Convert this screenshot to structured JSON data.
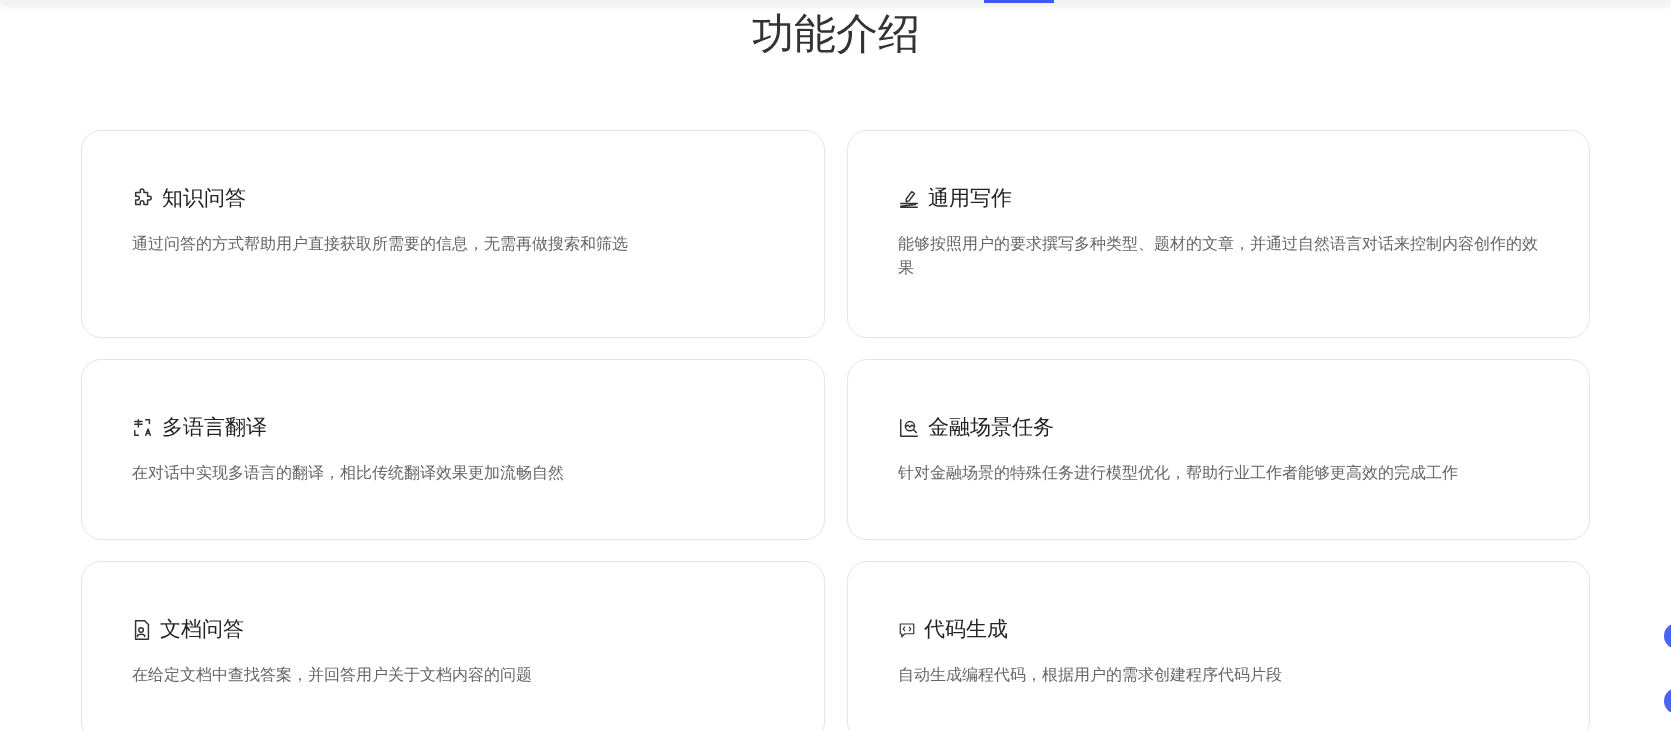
{
  "section_title": "功能介绍",
  "features": [
    {
      "title": "知识问答",
      "description": "通过问答的方式帮助用户直接获取所需要的信息，无需再做搜索和筛选"
    },
    {
      "title": "通用写作",
      "description": "能够按照用户的要求撰写多种类型、题材的文章，并通过自然语言对话来控制内容创作的效果"
    },
    {
      "title": "多语言翻译",
      "description": "在对话中实现多语言的翻译，相比传统翻译效果更加流畅自然"
    },
    {
      "title": "金融场景任务",
      "description": "针对金融场景的特殊任务进行模型优化，帮助行业工作者能够更高效的完成工作"
    },
    {
      "title": "文档问答",
      "description": "在给定文档中查找答案，并回答用户关于文档内容的问题"
    },
    {
      "title": "代码生成",
      "description": "自动生成编程代码，根据用户的需求创建程序代码片段"
    }
  ]
}
